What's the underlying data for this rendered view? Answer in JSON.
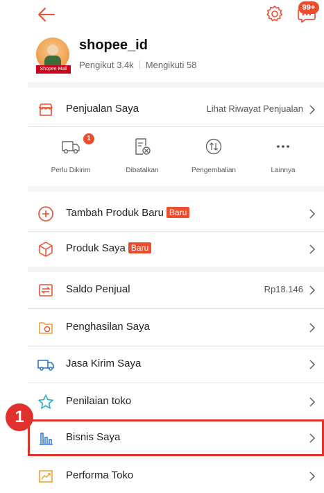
{
  "header": {
    "chat_badge": "99+"
  },
  "profile": {
    "shop_name": "shopee_id",
    "mall_tag": "Shopee Mall",
    "followers": "Pengikut 3.4k",
    "following": "Mengikuti 58"
  },
  "sales": {
    "label": "Penjualan Saya",
    "link": "Lihat Riwayat Penjualan"
  },
  "order_status": [
    {
      "label": "Perlu Dikirim",
      "badge": "1",
      "icon": "truck-icon"
    },
    {
      "label": "Dibatalkan",
      "icon": "cancelled-doc-icon"
    },
    {
      "label": "Pengembalian",
      "icon": "return-icon"
    },
    {
      "label": "Lainnya",
      "icon": "more-icon"
    }
  ],
  "products": [
    {
      "label": "Tambah Produk Baru",
      "badge": "Baru",
      "icon": "add-circle-icon"
    },
    {
      "label": "Produk Saya",
      "badge": "Baru",
      "icon": "box-icon"
    }
  ],
  "finance": [
    {
      "label": "Saldo Penjual",
      "value": "Rp18.146",
      "icon": "wallet-icon"
    },
    {
      "label": "Penghasilan Saya",
      "icon": "income-icon"
    },
    {
      "label": "Jasa Kirim Saya",
      "icon": "shipping-truck-icon"
    },
    {
      "label": "Penilaian toko",
      "icon": "star-icon"
    },
    {
      "label": "Bisnis Saya",
      "icon": "bar-chart-icon"
    },
    {
      "label": "Performa Toko",
      "icon": "performance-chart-icon"
    }
  ],
  "annotation": {
    "step": "1"
  },
  "colors": {
    "accent": "#ee4d2d",
    "highlight": "#e0312d"
  }
}
